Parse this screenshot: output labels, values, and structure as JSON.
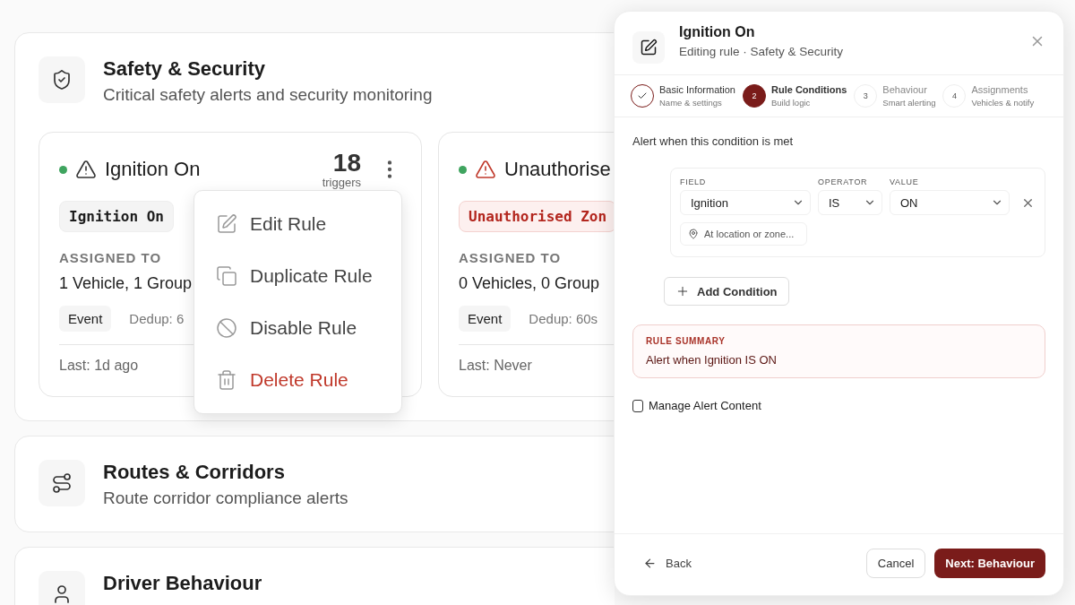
{
  "sections": [
    {
      "title": "Safety & Security",
      "subtitle": "Critical safety alerts and security monitoring",
      "rules": [
        {
          "name": "Ignition On",
          "active": true,
          "critical": false,
          "trigger_count": "18",
          "trigger_label": "triggers",
          "badge": "Ignition On",
          "badge_alert": false,
          "assigned_label": "ASSIGNED TO",
          "assigned": "1 Vehicle, 1 Group",
          "type": "Event",
          "dedup": "Dedup: 6",
          "last": "Last: 1d ago",
          "menu": [
            {
              "label": "Edit Rule",
              "kind": "edit"
            },
            {
              "label": "Duplicate Rule",
              "kind": "duplicate"
            },
            {
              "label": "Disable Rule",
              "kind": "disable"
            },
            {
              "label": "Delete Rule",
              "kind": "delete"
            }
          ]
        },
        {
          "name": "Unauthorise",
          "active": true,
          "critical": true,
          "badge": "Unauthorised Zon",
          "badge_alert": true,
          "assigned_label": "ASSIGNED TO",
          "assigned": "0 Vehicles, 0 Group",
          "type": "Event",
          "dedup": "Dedup: 60s",
          "last": "Last: Never"
        }
      ]
    },
    {
      "title": "Routes & Corridors",
      "subtitle": "Route corridor compliance alerts"
    },
    {
      "title": "Driver Behaviour"
    }
  ],
  "panel": {
    "title": "Ignition On",
    "subtitle": "Editing rule · Safety & Security",
    "steps": [
      {
        "title": "Basic Information",
        "subtitle": "Name & settings",
        "completed": true,
        "selected": false
      },
      {
        "number": "2",
        "title": "Rule Conditions",
        "subtitle": "Build logic",
        "completed": false,
        "selected": true
      },
      {
        "number": "3",
        "title": "Behaviour",
        "subtitle": "Smart alerting",
        "completed": false,
        "selected": false
      },
      {
        "number": "4",
        "title": "Assignments",
        "subtitle": "Vehicles & notify",
        "completed": false,
        "selected": false
      }
    ],
    "prompt": "Alert when this condition is met",
    "columns": [
      "FIELD",
      "OPERATOR",
      "VALUE"
    ],
    "conditions": [
      {
        "field": "Ignition",
        "operator": "IS",
        "value": "ON",
        "location_placeholder": "At location or zone..."
      }
    ],
    "add_button": "Add Condition",
    "summary_label": "RULE SUMMARY",
    "summary": "Alert when Ignition IS ON",
    "manage_content": {
      "label": "Manage Alert Content",
      "checked": false
    },
    "back": "Back",
    "cancel": "Cancel",
    "next": "Next: Behaviour"
  }
}
